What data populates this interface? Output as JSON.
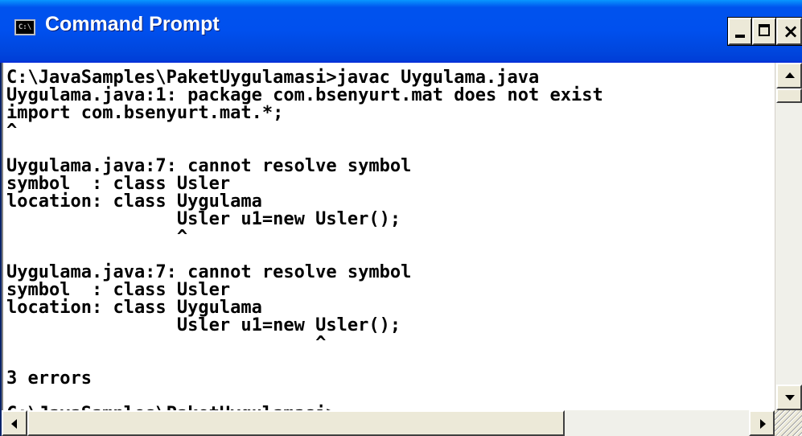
{
  "window": {
    "title": "Command Prompt",
    "icon": "console-icon",
    "icon_label": "C:\\",
    "controls": {
      "minimize_icon": "minimize-icon",
      "maximize_icon": "maximize-icon",
      "close_icon": "close-icon",
      "close_glyph": "×"
    }
  },
  "console": {
    "lines": [
      "C:\\JavaSamples\\PaketUygulamasi>javac Uygulama.java",
      "Uygulama.java:1: package com.bsenyurt.mat does not exist",
      "import com.bsenyurt.mat.*;",
      "^",
      "",
      "Uygulama.java:7: cannot resolve symbol",
      "symbol  : class Usler",
      "location: class Uygulama",
      "                Usler u1=new Usler();",
      "                ^",
      "",
      "Uygulama.java:7: cannot resolve symbol",
      "symbol  : class Usler",
      "location: class Uygulama",
      "                Usler u1=new Usler();",
      "                             ^",
      "",
      "3 errors",
      "",
      "C:\\JavaSamples\\PaketUygulamasi>"
    ]
  },
  "colors": {
    "titlebar": "#0053ee",
    "console_bg": "#ffffff",
    "console_fg": "#000000"
  }
}
